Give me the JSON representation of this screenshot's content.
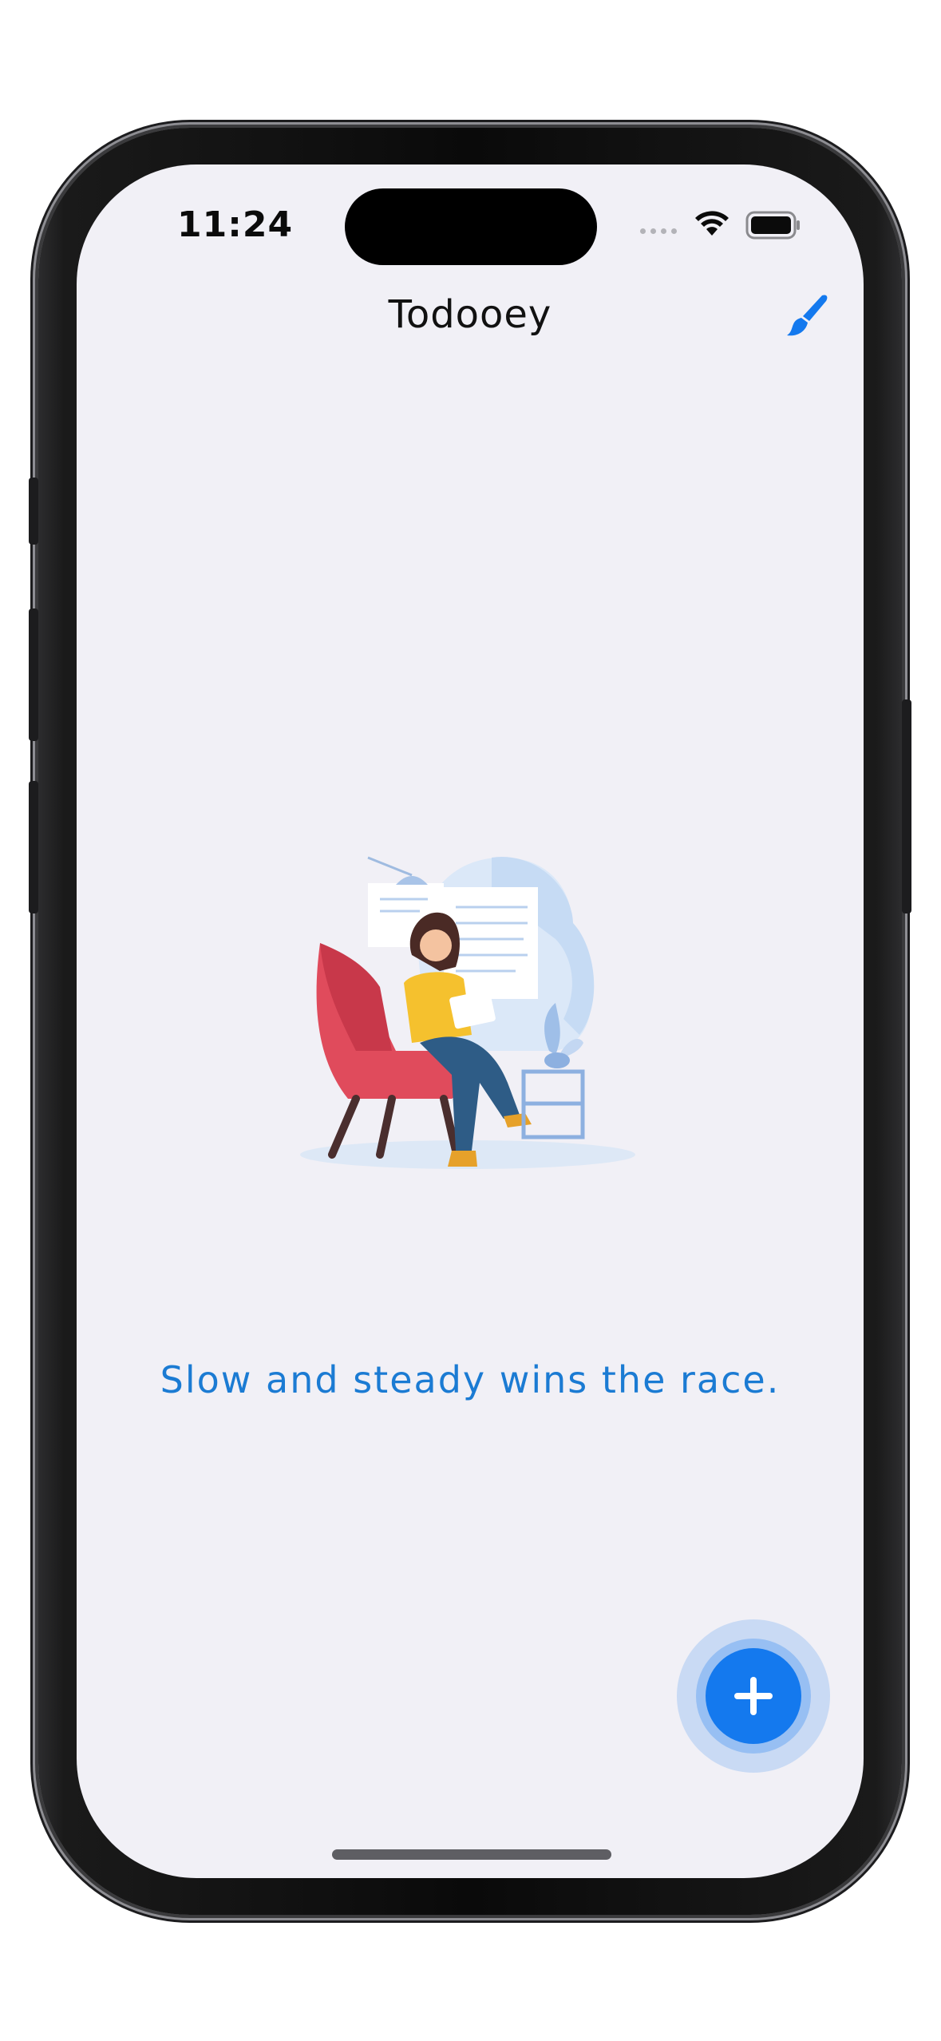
{
  "status_bar": {
    "time": "11:24"
  },
  "nav": {
    "title": "Todooey",
    "theme_icon": "paintbrush-icon"
  },
  "empty_state": {
    "illustration": "woman-reading-in-armchair-illustration",
    "quote": "Slow and steady wins the race."
  },
  "fab": {
    "icon": "plus-icon"
  },
  "colors": {
    "background": "#f1f0f6",
    "accent": "#1479ee",
    "quote_text": "#1b7bd3",
    "title_text": "#111111"
  }
}
